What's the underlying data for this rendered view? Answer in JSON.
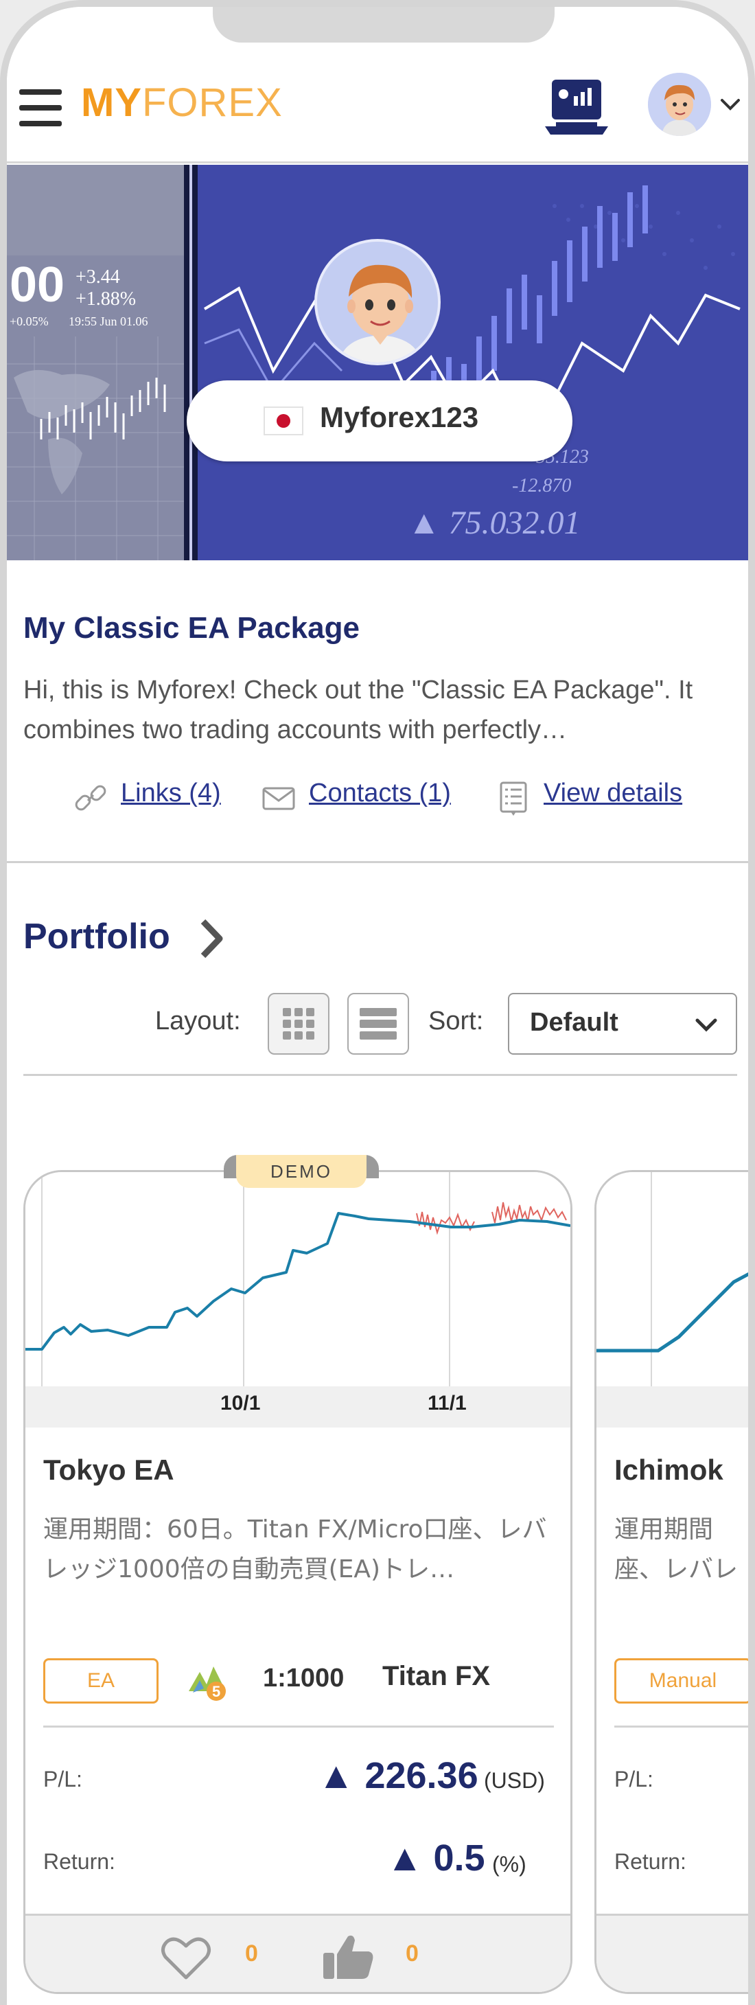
{
  "header": {
    "logo_my": "MY",
    "logo_forex": "FOREX"
  },
  "banner": {
    "left_big": "00",
    "left_change_abs": "+3.44",
    "left_change_pct": "+1.88%",
    "left_small_a": "+0.05%",
    "left_small_b": "19:55 Jun 01.06",
    "num1": "+55.123",
    "num2": "-12.870",
    "num3": "▲ 75.032.01",
    "username": "Myforex123"
  },
  "package": {
    "title": "My Classic EA Package",
    "description": "Hi, this is Myforex! Check out the \"Classic EA Package\". It combines two trading accounts with perfectly…"
  },
  "links": {
    "links_label": "Links (4)",
    "contacts_label": "Contacts (1)",
    "details_label": "View details"
  },
  "portfolio": {
    "title": "Portfolio",
    "layout_label": "Layout:",
    "sort_label": "Sort:",
    "sort_value": "Default"
  },
  "cards": [
    {
      "badge": "DEMO",
      "x_ticks": [
        "10/1",
        "11/1"
      ],
      "title": "Tokyo EA",
      "description": "運用期間：60日。Titan FX/Micro口座、レバレッジ1000倍の自動売買(EA)トレ…",
      "tag": "EA",
      "platform_icon": "mt5-icon",
      "leverage": "1:1000",
      "broker": "Titan FX",
      "pl_label": "P/L:",
      "pl_value": "▲ 226.36",
      "pl_unit": "(USD)",
      "return_label": "Return:",
      "return_value": "▲ 0.5",
      "return_unit": "(%)",
      "likes": "0",
      "thumbs": "0"
    },
    {
      "title": "Ichimok",
      "description": "運用期間\n座、レバレ",
      "tag": "Manual",
      "pl_label": "P/L:",
      "return_label": "Return:"
    }
  ],
  "colors": {
    "brand_orange": "#f39a1e",
    "navy": "#1f2a6b",
    "link_blue": "#2b3890",
    "chart_line": "#1a7fa8",
    "chart_red": "#e0655f"
  }
}
